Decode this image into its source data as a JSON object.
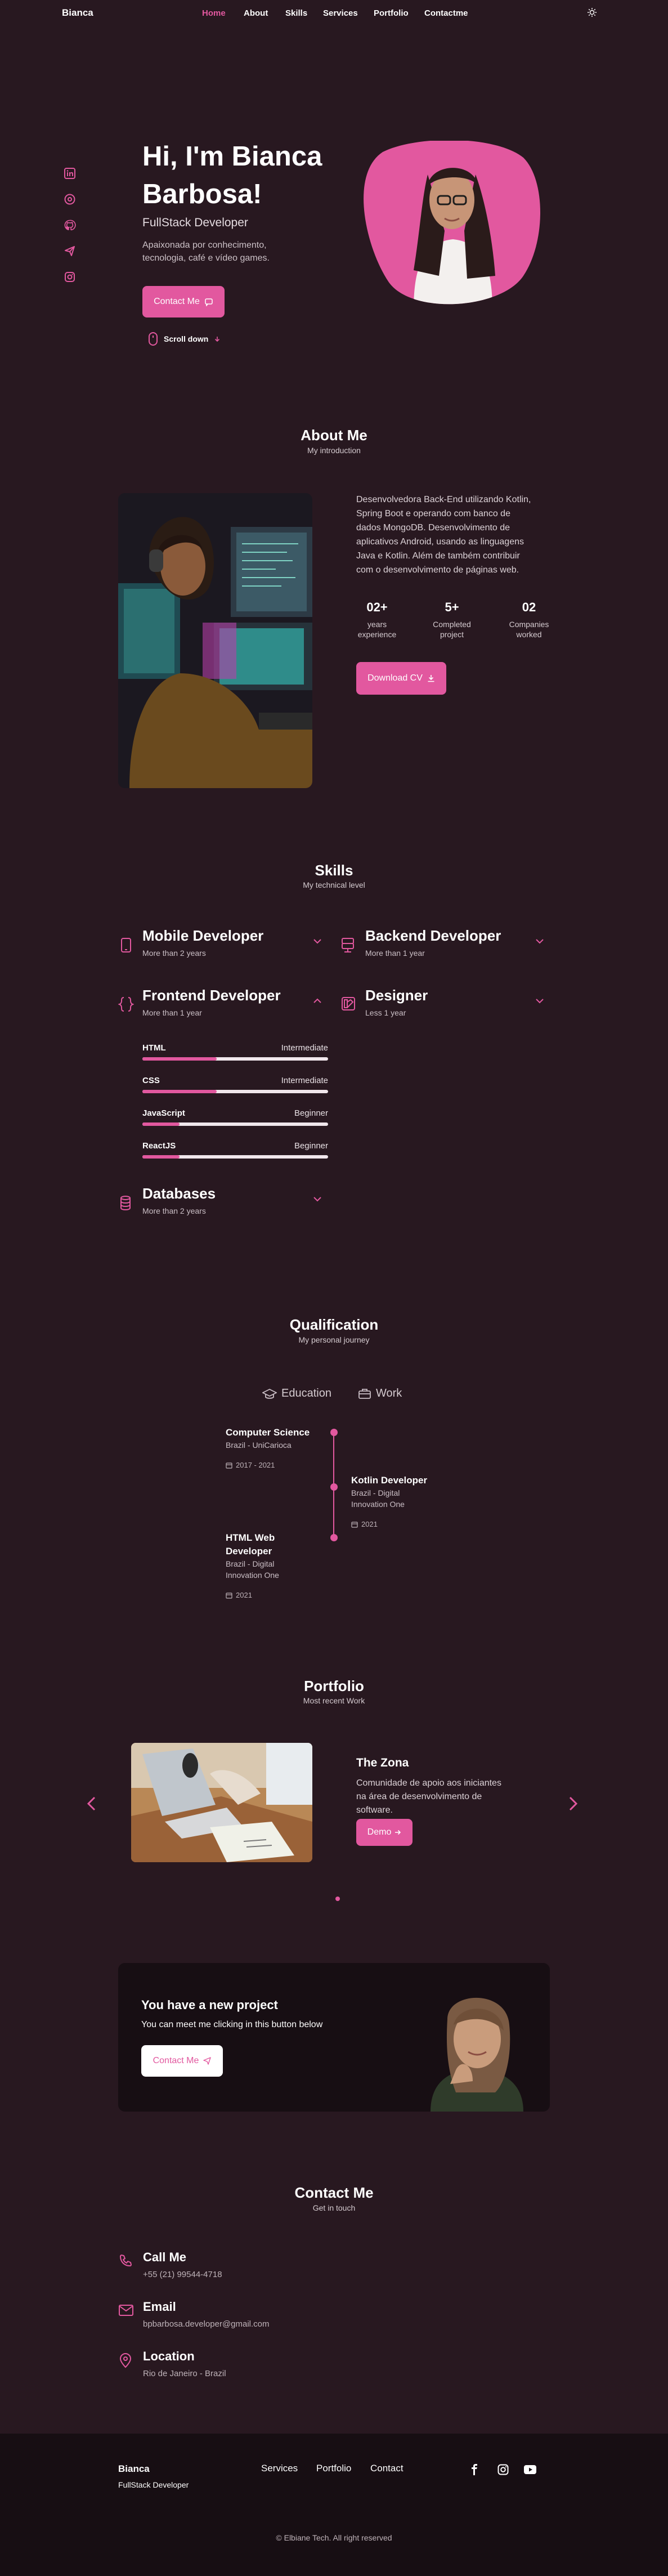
{
  "header": {
    "logo": "Bianca",
    "nav": [
      "Home",
      "About",
      "Skills",
      "Services",
      "Portfolio",
      "Contactme"
    ],
    "theme_icon": "sun-icon"
  },
  "home": {
    "social_icons": [
      "linkedin-icon",
      "dribbble-icon",
      "github-icon",
      "send-icon",
      "instagram-icon"
    ],
    "title_line1": "Hi, I'm Bianca",
    "title_line2": "Barbosa!",
    "subtitle": "FullStack Developer",
    "description_line1": "Apaixonada por conhecimento,",
    "description_line2": "tecnologia, café e vídeo games.",
    "contact_button": "Contact Me",
    "scroll_label": "Scroll down",
    "accent": "#e2589f"
  },
  "about": {
    "title": "About Me",
    "subtitle": "My introduction",
    "description": [
      "Desenvolvedora Back-End utilizando Kotlin,",
      "Spring Boot e operando com banco de",
      "dados MongoDB. Desenvolvimento de",
      "aplicativos Android, usando as linguagens",
      "Java e Kotlin. Além de também contribuir",
      "com o desenvolvimento de páginas web."
    ],
    "stats": [
      {
        "value": "02+",
        "label1": "years",
        "label2": "experience"
      },
      {
        "value": "5+",
        "label1": "Completed",
        "label2": "project"
      },
      {
        "value": "02",
        "label1": "Companies",
        "label2": "worked"
      }
    ],
    "download_button": "Download CV"
  },
  "skills": {
    "title": "Skills",
    "subtitle": "My technical level",
    "groups": [
      {
        "title": "Mobile Developer",
        "sub": "More than 2 years"
      },
      {
        "title": "Backend Developer",
        "sub": "More than 1 year"
      },
      {
        "title": "Frontend Developer",
        "sub": "More than 1 year"
      },
      {
        "title": "Designer",
        "sub": "Less 1 year"
      },
      {
        "title": "Databases",
        "sub": "More than 2 years"
      }
    ],
    "bars": [
      {
        "name": "HTML",
        "level": "Intermediate",
        "fill": 0.4
      },
      {
        "name": "CSS",
        "level": "Intermediate",
        "fill": 0.4
      },
      {
        "name": "JavaScript",
        "level": "Beginner",
        "fill": 0.2
      },
      {
        "name": "ReactJS",
        "level": "Beginner",
        "fill": 0.2
      }
    ]
  },
  "qualification": {
    "title": "Qualification",
    "subtitle": "My personal journey",
    "tab_education": "Education",
    "tab_work": "Work",
    "items": [
      {
        "title": "Computer Science",
        "sub": "Brazil - UniCarioca",
        "date": "2017 - 2021"
      },
      {
        "title1": "Kotlin Developer",
        "sub1": "Brazil - Digital",
        "sub2": "Innovation One",
        "date": "2021"
      },
      {
        "title1": "HTML Web",
        "title2": "Developer",
        "sub1": "Brazil - Digital",
        "sub2": "Innovation One",
        "date": "2021"
      }
    ]
  },
  "portfolio": {
    "title": "Portfolio",
    "subtitle": "Most recent Work",
    "project_title": "The Zona",
    "project_desc": [
      "Comunidade de apoio aos iniciantes",
      "na área de desenvolvimento de",
      "software."
    ],
    "demo_button": "Demo"
  },
  "project_banner": {
    "title": "You have a new project",
    "sub": "You can meet me clicking in this button below",
    "button": "Contact Me"
  },
  "contact": {
    "title": "Contact Me",
    "subtitle": "Get in touch",
    "items": [
      {
        "title": "Call Me",
        "value": "+55 (21) 99544-4718"
      },
      {
        "title": "Email",
        "value": "bpbarbosa.developer@gmail.com"
      },
      {
        "title": "Location",
        "value": "Rio de Janeiro - Brazil"
      }
    ]
  },
  "footer": {
    "name": "Bianca",
    "role": "FullStack Developer",
    "links": [
      "Services",
      "Portfolio",
      "Contact"
    ],
    "social_icons": [
      "facebook-icon",
      "instagram-icon",
      "youtube-icon"
    ],
    "copyright": "© Elbiane Tech. All right reserved"
  }
}
